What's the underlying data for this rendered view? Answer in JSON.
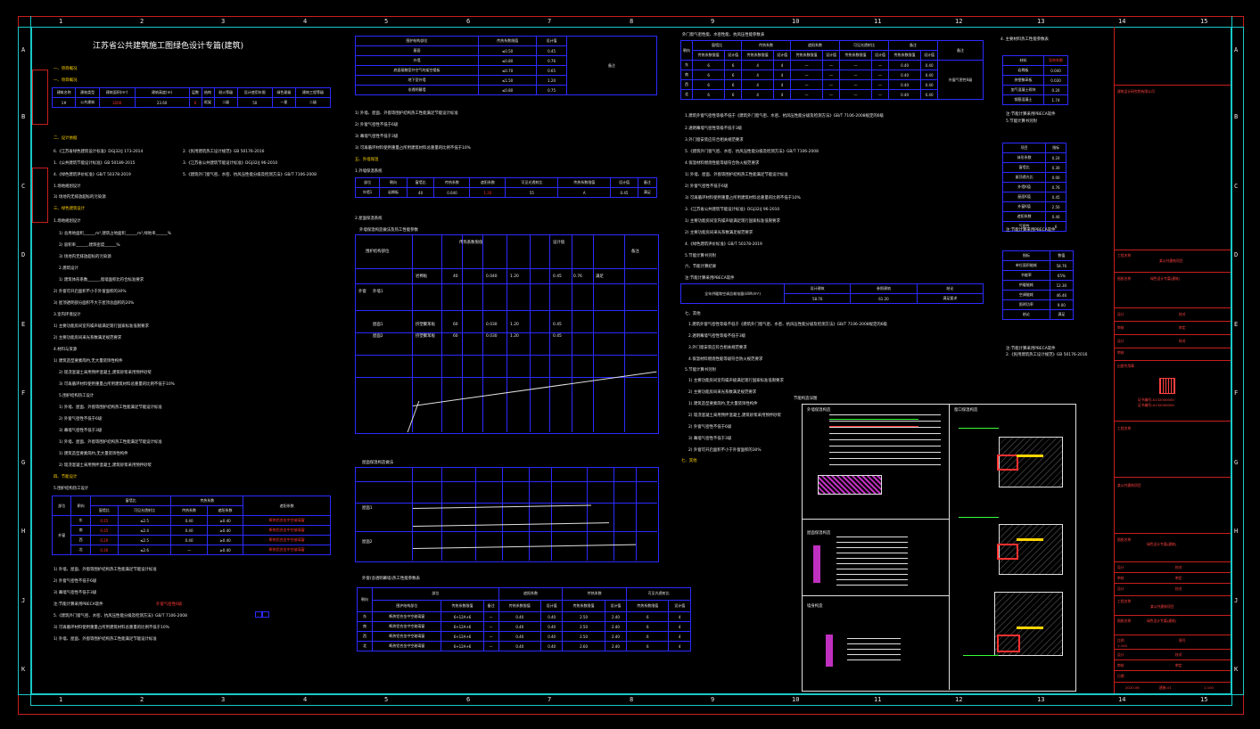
{
  "drawing": {
    "title": "江苏省公共建筑施工图绿色设计专篇(建筑)",
    "col_numbers": [
      "1",
      "2",
      "3",
      "4",
      "5",
      "6",
      "7",
      "8",
      "9",
      "10",
      "11",
      "12",
      "13",
      "14",
      "15"
    ],
    "row_letters": [
      "A",
      "B",
      "C",
      "D",
      "E",
      "F",
      "G",
      "H",
      "J",
      "K"
    ]
  },
  "left_column": {
    "sec1": "一、项目概况",
    "sec2": "二、设计依据",
    "sec3": "三、绿色建筑设计",
    "sec4": "四、节能设计",
    "ref1": "1.《公共建筑节能设计标准》GB 50189-2015",
    "ref2": "2.《民用建筑热工设计规范》GB 50176-2016",
    "ref3": "3.《江苏省公共建筑节能设计标准》DGJ32/J 96-2010",
    "ref4": "4.《绿色建筑评价标准》GB/T 50378-2019",
    "ref5": "5.《建筑外门窗气密、水密、抗风压性能分级及检测方法》GB/T 7106-2008",
    "ref6": "6.《江苏省绿色建筑设计标准》DGJ32/J 173-2014",
    "line_a": "1.场地规划设计",
    "line_b": "1) 总用地面积______m²,建筑占地面积______m²,绿地率______%",
    "line_c": "2) 容积率______,建筑密度______%",
    "line_d": "3) 场地内无排放超标的污染源",
    "line_e": "2.建筑设计",
    "line_f": "1) 建筑体形系数______,窗墙面积比符合标准要求",
    "line_g": "2) 外窗可开启面积不小于外窗面积的30%",
    "line_h": "3) 屋顶透明部分面积不大于屋顶总面积的20%",
    "line_i": "3.室内环境设计",
    "line_j": "1) 主要功能房间室内噪声级满足现行国家标准低限要求",
    "line_k": "2) 主要功能房间采光系数满足规范要求",
    "line_l": "4.材料与资源",
    "line_m": "1) 建筑造型要素简约,无大量装饰性构件",
    "line_n": "2) 现浇混凝土采用预拌混凝土,建筑砂浆采用预拌砂浆",
    "line_o": "3) 可再循环材料使用重量占所用建筑材料总重量的比例不低于10%",
    "line_p": "5.围护结构热工设计",
    "line_q": "1) 外墙、屋面、外窗等围护结构热工性能满足节能设计标准",
    "line_r": "2) 外窗气密性不低于6级",
    "line_s": "3) 幕墙气密性不低于3级",
    "note1": "注:节能计算采用PBECA软件",
    "red_note": "外窗气密性6级",
    "table1_headers": [
      "建筑名称",
      "建筑类型",
      "建筑面积(m²)",
      "建筑高度(m)",
      "层数",
      "结构",
      "耐火等级",
      "设计使用年限",
      "绿色星级",
      "建筑工程等级"
    ],
    "table1_row": [
      "1#",
      "公共建筑",
      "3200",
      "23.60",
      "6",
      "框架",
      "二级",
      "50",
      "一星",
      "二级"
    ],
    "table2_headers": [
      "部位",
      "朝向",
      "窗墙比",
      "传热系数",
      "遮阳系数",
      "可见光透射比"
    ],
    "table2_rows": [
      [
        "外窗",
        "东",
        "0.25",
        "≤2.5",
        "0.40",
        "≥0.40"
      ],
      [
        "",
        "南",
        "0.35",
        "≤2.4",
        "0.40",
        "≥0.40"
      ],
      [
        "",
        "西",
        "0.20",
        "≤2.5",
        "0.40",
        "≥0.40"
      ],
      [
        "",
        "北",
        "0.30",
        "≤2.6",
        "—",
        "≥0.40"
      ]
    ],
    "table2_red": [
      "断热铝合金中空玻璃窗",
      "断热铝合金中空玻璃窗",
      "断热铝合金中空玻璃窗",
      "断热铝合金中空玻璃窗"
    ]
  },
  "middle_column": {
    "t3_headers": [
      "围护结构部位",
      "传热系数限值",
      "设计值",
      "备注"
    ],
    "t3_rows": [
      [
        "屋面",
        "≤0.50",
        "0.45",
        ""
      ],
      [
        "外墙",
        "≤0.80",
        "0.76",
        ""
      ],
      [
        "底面接触室外空气的架空楼板",
        "≤0.70",
        "0.65",
        ""
      ],
      [
        "地下室外墙",
        "≤1.50",
        "1.20",
        ""
      ],
      [
        "非透明幕墙",
        "≤0.80",
        "0.75",
        ""
      ]
    ],
    "sec5": "五、外墙保温",
    "sub1": "1.外墙保温系统",
    "sub2": "2.屋面保温系统",
    "t4_title": "外墙保温构造做法及热工性能参数",
    "t5_title": "屋面保温构造做法",
    "t6_title": "外窗(含透明幕墙)热工性能参数表",
    "t4_row": [
      "外墙1",
      "岩棉板",
      "40",
      "0.040",
      "1.20",
      "55",
      "A",
      "0.45",
      "0.76",
      "满足"
    ],
    "t5_rows": [
      [
        "屋面1",
        "挤塑聚苯板",
        "60",
        "0.030",
        "1.20",
        "25",
        "B1",
        "0.45",
        ""
      ],
      [
        "屋面2",
        "挤塑聚苯板",
        "60",
        "0.030",
        "1.20",
        "25",
        "B1",
        "0.45",
        ""
      ]
    ],
    "t6_rows": [
      [
        "东",
        "断热铝合金中空玻璃窗",
        "6+12A+6",
        "—",
        "0.40",
        "0.40",
        "2.50",
        "2.40",
        "6",
        "4"
      ],
      [
        "南",
        "断热铝合金中空玻璃窗",
        "6+12A+6",
        "—",
        "0.40",
        "0.40",
        "2.50",
        "2.40",
        "6",
        "4"
      ],
      [
        "西",
        "断热铝合金中空玻璃窗",
        "6+12A+6",
        "—",
        "0.40",
        "0.40",
        "2.50",
        "2.40",
        "6",
        "4"
      ],
      [
        "北",
        "断热铝合金中空玻璃窗",
        "6+12A+6",
        "—",
        "0.40",
        "0.40",
        "2.60",
        "2.40",
        "6",
        "4"
      ]
    ]
  },
  "right_column": {
    "t7_title": "外门窗气密性能、水密性能、抗风压性能参数表",
    "sec6": "六、节能计算结果",
    "sec7": "七、其他",
    "note_a": "1.建筑外窗气密性等级不低于《建筑外门窗气密、水密、抗风压性能分级及检测方法》GB/T 7106-2008规定的6级",
    "note_b": "2.透明幕墙气密性等级不低于3级",
    "note_c": "3.外门窗安装应符合相关规范要求",
    "note_d": "4.保温材料燃烧性能等级符合防火规范要求",
    "note_e": "5.节能计算书另附",
    "t8_headers": [
      "全年供暖和空调总耗电量(kWh/m²)",
      "设计建筑",
      "参照建筑",
      "结论"
    ],
    "t8_row": [
      "",
      "58.76",
      "61.20",
      "满足要求"
    ],
    "detail_title": "节能构造详图",
    "d1": "外墙保温构造",
    "d2": "屋面保温构造",
    "d3": "窗口保温构造",
    "d4": "墙身构造",
    "side_title": "4. 主要材料热工性能参数表",
    "side1": [
      [
        "材料",
        "导热系数"
      ],
      [
        "岩棉板",
        "0.040"
      ],
      [
        "挤塑聚苯板",
        "0.030"
      ],
      [
        "加气混凝土砌块",
        "0.20"
      ],
      [
        "钢筋混凝土",
        "1.74"
      ]
    ],
    "side2": [
      [
        "项目",
        "指标"
      ],
      [
        "体形系数",
        "0.24"
      ],
      [
        "窗墙比",
        "0.30"
      ],
      [
        "屋顶透光比",
        "0.00"
      ],
      [
        "外墙K值",
        "0.76"
      ],
      [
        "屋面K值",
        "0.45"
      ],
      [
        "外窗K值",
        "2.50"
      ],
      [
        "遮阳系数",
        "0.40"
      ],
      [
        "气密性",
        "6"
      ]
    ],
    "side3": [
      [
        "指标",
        "数值"
      ],
      [
        "单位面积能耗",
        "58.76"
      ],
      [
        "节能率",
        "65%"
      ],
      [
        "供暖能耗",
        "12.30"
      ],
      [
        "空调能耗",
        "46.46"
      ],
      [
        "照明功率",
        "9.00"
      ],
      [
        "结论",
        "满足"
      ]
    ]
  },
  "title_block": {
    "company": "建筑设计研究院有限公司",
    "project_label": "工程名称",
    "project": "某公共建筑项目",
    "drawing_label": "图纸名称",
    "drawing_name": "绿色设计专篇(建筑)",
    "stamp": "出图专用章",
    "cert": "证书编号:A132000000",
    "design": "设计",
    "check": "校对",
    "review": "审核",
    "approve": "审定",
    "scale_label": "比例",
    "scale": "1:100",
    "sheet_label": "图号",
    "sheet": "建施-01",
    "date_label": "日期",
    "date": "2020.06"
  }
}
